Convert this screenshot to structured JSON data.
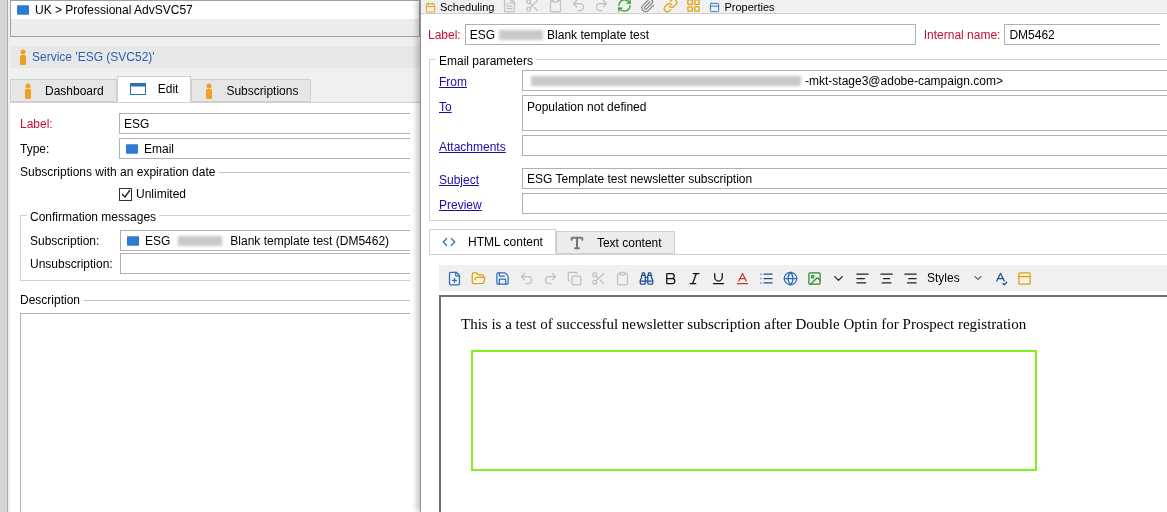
{
  "left": {
    "breadcrumb": "UK > Professional AdvSVC57",
    "service_title": "Service 'ESG (SVC52)'",
    "tabs": [
      {
        "label": "Dashboard",
        "selected": false,
        "kind": "person"
      },
      {
        "label": "Edit",
        "selected": true,
        "kind": "window"
      },
      {
        "label": "Subscriptions",
        "selected": false,
        "kind": "person"
      }
    ],
    "label": {
      "label": "Label:",
      "value": "ESG"
    },
    "type": {
      "label": "Type:",
      "value": "Email"
    },
    "expiration": {
      "title": "Subscriptions with an expiration date",
      "unlimited": {
        "label": "Unlimited",
        "checked": true
      }
    },
    "confirmation": {
      "title": "Confirmation messages",
      "subscription": {
        "label": "Subscription:",
        "value_start": "ESG",
        "value_end": "Blank template test (DM5462)"
      },
      "unsubscription": {
        "label": "Unsubscription:"
      }
    },
    "description": {
      "title": "Description"
    }
  },
  "right": {
    "toolbar": {
      "scheduling": "Scheduling",
      "properties": "Properties"
    },
    "label": {
      "label": "Label:",
      "value_start": "ESG",
      "value_end": "Blank template test"
    },
    "internal_name": {
      "label": "Internal name:",
      "value": "DM5462"
    },
    "email_parameters": {
      "title": "Email parameters",
      "fields": [
        {
          "link": "From",
          "value": "-mkt-stage3@adobe-campaign.com>",
          "redacted": true,
          "multiline": false
        },
        {
          "link": "To",
          "value": "Population not defined",
          "redacted": false,
          "multiline": true
        },
        {
          "link": "Attachments",
          "redacted": false,
          "multiline": false
        },
        {
          "link": "Subject",
          "value": "ESG Template test newsletter subscription",
          "redacted": false,
          "multiline": false
        },
        {
          "link": "Preview",
          "redacted": false,
          "multiline": false
        }
      ]
    },
    "content_tabs": [
      {
        "label": "HTML content",
        "selected": true,
        "kind": "html"
      },
      {
        "label": "Text content",
        "selected": false,
        "kind": "text"
      }
    ],
    "editor_toolbar": {
      "styles": "Styles"
    },
    "body_text": "This is a test of successful newsletter subscription after Double Optin for Prospect registration"
  }
}
